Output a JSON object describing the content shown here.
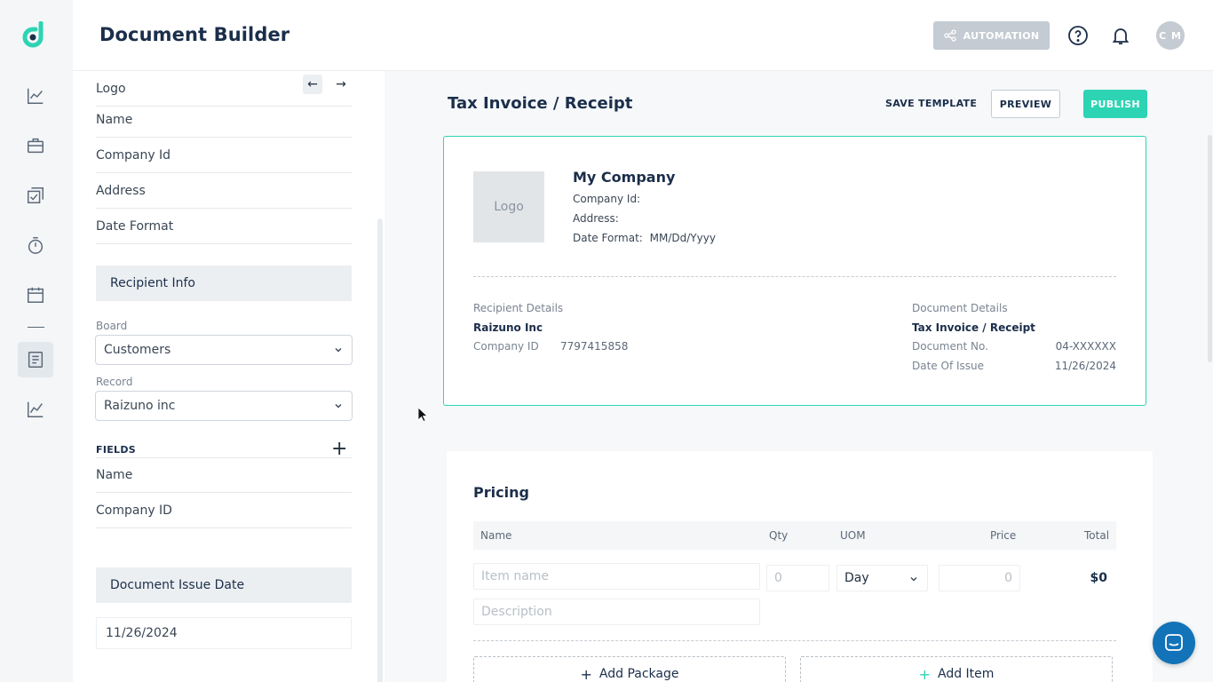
{
  "app": {
    "title": "Document Builder"
  },
  "header": {
    "automation_label": "AUTOMATION",
    "avatar_initials": "C M"
  },
  "rail": {
    "icons": [
      "analytics-icon",
      "briefcase-icon",
      "checklist-icon",
      "timer-icon",
      "calendar-icon",
      "document-icon",
      "chart-icon"
    ],
    "active": "document-icon"
  },
  "panel": {
    "company_fields": [
      "Logo",
      "Name",
      "Company Id",
      "Address",
      "Date Format"
    ],
    "recipient_section": "Recipient Info",
    "board_label": "Board",
    "board_value": "Customers",
    "record_label": "Record",
    "record_value": "Raizuno inc",
    "fields_heading": "FIELDS",
    "fields": [
      "Name",
      "Company ID"
    ],
    "issue_date_section": "Document Issue Date",
    "issue_date_value": "11/26/2024"
  },
  "main": {
    "doc_title": "Tax Invoice / Receipt",
    "save_template": "SAVE TEMPLATE",
    "preview": "PREVIEW",
    "publish": "PUBLISH"
  },
  "card": {
    "logo_placeholder": "Logo",
    "company_name": "My Company",
    "company_id_label": "Company Id:",
    "address_label": "Address:",
    "date_format_label": "Date Format:",
    "date_format_value": "MM/Dd/Yyyy",
    "recipient_heading": "Recipient Details",
    "recipient_name": "Raizuno Inc",
    "recipient_company_id_label": "Company ID",
    "recipient_company_id_value": "7797415858",
    "document_heading": "Document Details",
    "document_type": "Tax Invoice / Receipt",
    "document_no_label": "Document No.",
    "document_no_value": "04-XXXXXX",
    "date_of_issue_label": "Date Of Issue",
    "date_of_issue_value": "11/26/2024"
  },
  "pricing": {
    "heading": "Pricing",
    "columns": {
      "name": "Name",
      "qty": "Qty",
      "uom": "UOM",
      "price": "Price",
      "total": "Total"
    },
    "item_name_placeholder": "Item name",
    "qty_placeholder": "0",
    "uom_value": "Day",
    "price_placeholder": "0",
    "total_value": "$0",
    "description_placeholder": "Description",
    "add_package": "Add Package",
    "add_item": "Add Item"
  },
  "colors": {
    "accent": "#2dd4b4",
    "navy": "#1b2e4a",
    "chat": "#1373b8",
    "disabled": "#c4cbd2"
  }
}
